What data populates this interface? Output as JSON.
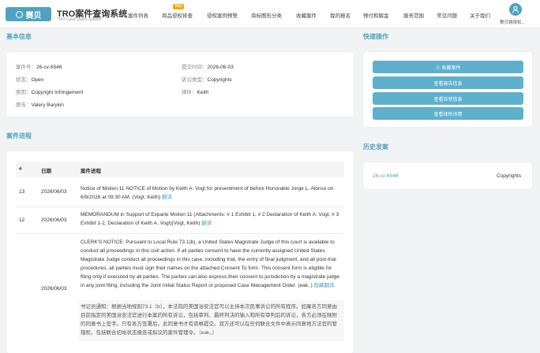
{
  "header": {
    "logo": "赛贝",
    "title": "TRO案件查询系统",
    "subtitle": "TRO Case Query System",
    "nav": [
      "案件列表",
      "商品侵权排查",
      "侵权案例预警",
      "商标图形分类",
      "收藏案件",
      "我的报名",
      "预付和解金",
      "服务范围",
      "常见问题",
      "关于我们"
    ],
    "hot": "Hot",
    "user": "赛贝跨境松..."
  },
  "basic": {
    "section": "基本信息",
    "fields": [
      {
        "label": "案件号：",
        "value": "26-cv-6546"
      },
      {
        "label": "提交时间：",
        "value": "2026-06-03"
      },
      {
        "label": "状态：",
        "value": "Open"
      },
      {
        "label": "诉讼类型：",
        "value": "Copyrights"
      },
      {
        "label": "原因：",
        "value": "Copyright Infringement"
      },
      {
        "label": "律所：",
        "value": "Keith"
      },
      {
        "label": "原告：",
        "value": "Valery Barykin"
      }
    ]
  },
  "quick": {
    "section": "快速操作",
    "buttons": [
      "☆ 收藏案件",
      "查看被告信息",
      "查看诉状信息",
      "查看律所详情"
    ]
  },
  "progress": {
    "section": "案件进程",
    "headers": [
      "#",
      "日期",
      "案件进程"
    ],
    "rows": [
      {
        "n": "13",
        "date": "2026/06/03",
        "text": "Notice of Motion 11 NOTICE of Motion by Keith A. Vogt for presentment of before Honorable Jorge L. Alonso on 6/9/2026 at 09:30 AM. (Vogt, Keith)",
        "link": "翻译"
      },
      {
        "n": "12",
        "date": "2026/06/03",
        "text": "MEMORANDUM in Support of Exparte Motion 11 (Attachments: # 1 Exhibit 1, # 2 Declaration of Keith A. Vogt, # 3 Exhibit 1-2, Declaration of Keith A. Vogt)(Vogt, Keith)",
        "link": "翻译"
      },
      {
        "n": "",
        "date": "2026/06/03",
        "text": "CLERK'S NOTICE: Pursuant to Local Rule 73.1(b), a United States Magistrate Judge of this court is available to conduct all proceedings in this civil action. If all parties consent to have the currently assigned United States Magistrate Judge conduct all proceedings in this case, including trial, the entry of final judgment, and all post-trial procedures, all parties must sign their names on the attached Consent To form. This consent form is eligible for filing only if executed by all parties. The parties can also express their consent to jurisdiction by a magistrate judge in any joint filing, including the Joint Initial Status Report or proposed Case Management Order. (eak, )",
        "link": "隐藏翻译",
        "translation": "书记员通知：根据当地规则73.1（b），本法院的美国治安法官可以主持本次民事诉讼的所有程序。如果各方同意由目前指定的美国治安法官进行本案的所有诉讼，包括审判、最终判决的输入和所有审判后的诉讼，各方必须在随附的同意书上签字。只有各方签署后，此同意书才有资格提交。双方还可以在任何联合文件中表示同意地方法官的管辖权，包括联合初始状态报告或拟议的案件管理令。（eak，）"
      }
    ]
  },
  "history": {
    "section": "历史发案",
    "case": "26-cv-6546",
    "type": "Copyrights"
  }
}
